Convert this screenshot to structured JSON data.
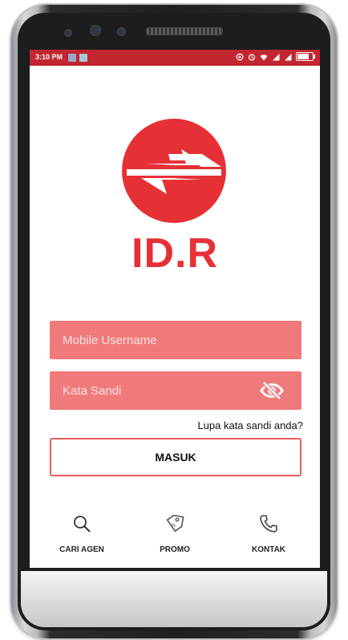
{
  "status_bar": {
    "time": "3:10 PM",
    "background": "#c2262e",
    "battery_level": 0.85,
    "left_icons": [
      "notification-icon",
      "notification-icon"
    ],
    "right_icons": [
      "data-saver-icon",
      "alarm-icon",
      "wifi-icon",
      "signal-icon",
      "signal-icon",
      "battery-icon"
    ]
  },
  "brand": {
    "name": "ID.R",
    "color": "#e53136",
    "logo_icon": "exchange-arrows-logo"
  },
  "form": {
    "username_placeholder": "Mobile Username",
    "password_placeholder": "Kata Sandi",
    "field_color": "#f07a7b",
    "password_toggle_icon": "eye-off-icon",
    "forgot_label": "Lupa kata sandi anda?",
    "submit_label": "MASUK"
  },
  "bottom_nav": [
    {
      "label": "CARI AGEN",
      "icon": "search-icon"
    },
    {
      "label": "PROMO",
      "icon": "tag-icon"
    },
    {
      "label": "KONTAK",
      "icon": "phone-icon"
    }
  ]
}
